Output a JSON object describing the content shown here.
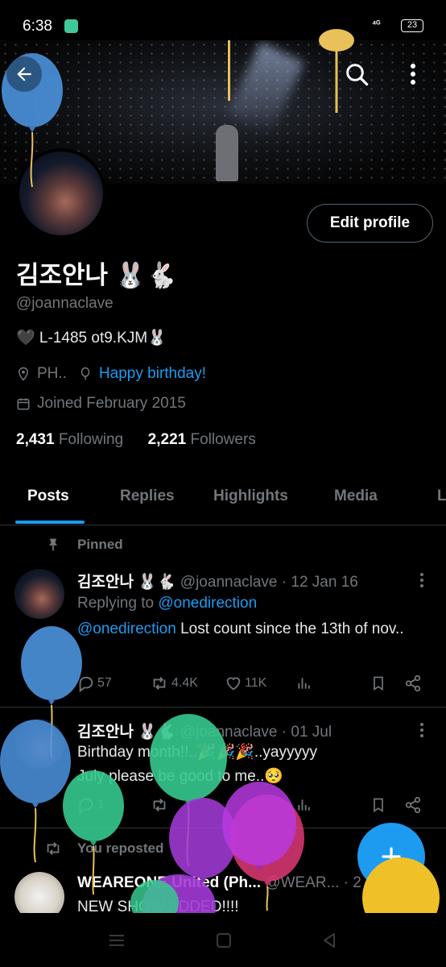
{
  "status_bar": {
    "time": "6:38",
    "network": "⁴ᴳ",
    "battery": "23"
  },
  "profile": {
    "display_name": "김조안나 🐰🐇",
    "handle": "@joannaclave",
    "bio": "🖤 L-1485 ot9.KJM🐰",
    "location": "PH..",
    "birthday": "Happy birthday!",
    "joined": "Joined February 2015",
    "following_count": "2,431",
    "following_label": "Following",
    "followers_count": "2,221",
    "followers_label": "Followers",
    "edit_button": "Edit profile"
  },
  "tabs": [
    "Posts",
    "Replies",
    "Highlights",
    "Media",
    "L"
  ],
  "pinned_label": "Pinned",
  "tweets": [
    {
      "name": "김조안나 🐰🐇",
      "meta": "@joannaclave · 12 Jan 16",
      "replying_prefix": "Replying to ",
      "replying_to": "@onedirection",
      "mention": "@onedirection",
      "text": " Lost count since the 13th of nov..",
      "replies": "57",
      "reposts": "4.4K",
      "likes": "11K"
    },
    {
      "name": "김조안나 🐰🐇",
      "meta": "@joannaclave · 01 Jul",
      "text": "Birthday month!!..🎉🎉🎉..yayyyyy\nJuly please be good to me..🥺",
      "replies": "1"
    },
    {
      "repost_label": "You reposted",
      "name": "WEAREONE United (Ph...",
      "meta": "@WEAR... · 2",
      "text": "NEW SHOW ADDED!!!!"
    }
  ],
  "colors": {
    "accent": "#1d9bf0",
    "background": "#000000",
    "secondary_text": "#71767b",
    "border": "#2f3336"
  },
  "icons": [
    "back-arrow-icon",
    "search-icon",
    "more-vertical-icon",
    "location-pin-icon",
    "balloon-icon",
    "calendar-icon",
    "pin-icon",
    "reply-icon",
    "repost-icon",
    "like-icon",
    "views-icon",
    "bookmark-icon",
    "share-icon",
    "compose-plus-icon",
    "menu-icon",
    "home-square-icon",
    "back-triangle-icon"
  ]
}
